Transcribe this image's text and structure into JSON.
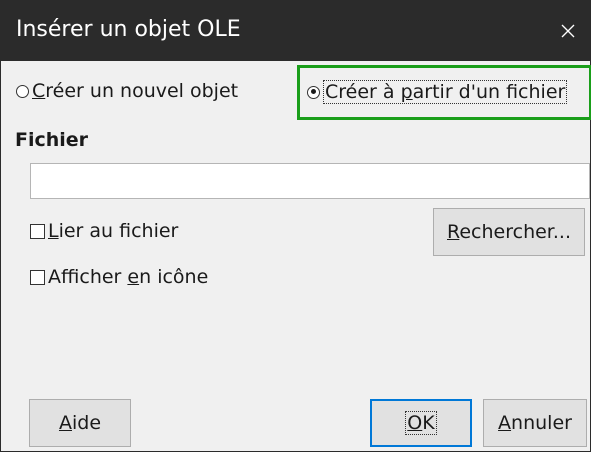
{
  "window": {
    "title": "Insérer un objet OLE",
    "close_glyph": "✕"
  },
  "options": {
    "new_object": {
      "pre": "",
      "mn": "C",
      "post": "réer un nouvel objet",
      "checked": false
    },
    "from_file": {
      "pre": "Créer à ",
      "mn": "p",
      "post": "artir d'un fichier",
      "checked": true
    }
  },
  "file_section": {
    "label": "Fichier",
    "input_value": "",
    "link_checkbox": {
      "pre": "",
      "mn": "L",
      "post": "ier au fichier",
      "checked": false
    },
    "icon_checkbox": {
      "pre": "Afficher ",
      "mn": "e",
      "post": "n icône",
      "checked": false
    },
    "browse_button": {
      "pre": "",
      "mn": "R",
      "post": "echercher..."
    }
  },
  "buttons": {
    "help": {
      "pre": "",
      "mn": "A",
      "post": "ide"
    },
    "ok": {
      "pre": "",
      "mn": "O",
      "post": "K"
    },
    "cancel": {
      "pre": "",
      "mn": "A",
      "post": "nnuler"
    }
  },
  "colors": {
    "titlebar": "#2b2b2b",
    "highlight": "#1a9e1a",
    "default_button_border": "#0078d7"
  },
  "icons": {
    "close": "close-icon",
    "radio": "radio-button",
    "checkbox": "checkbox"
  }
}
